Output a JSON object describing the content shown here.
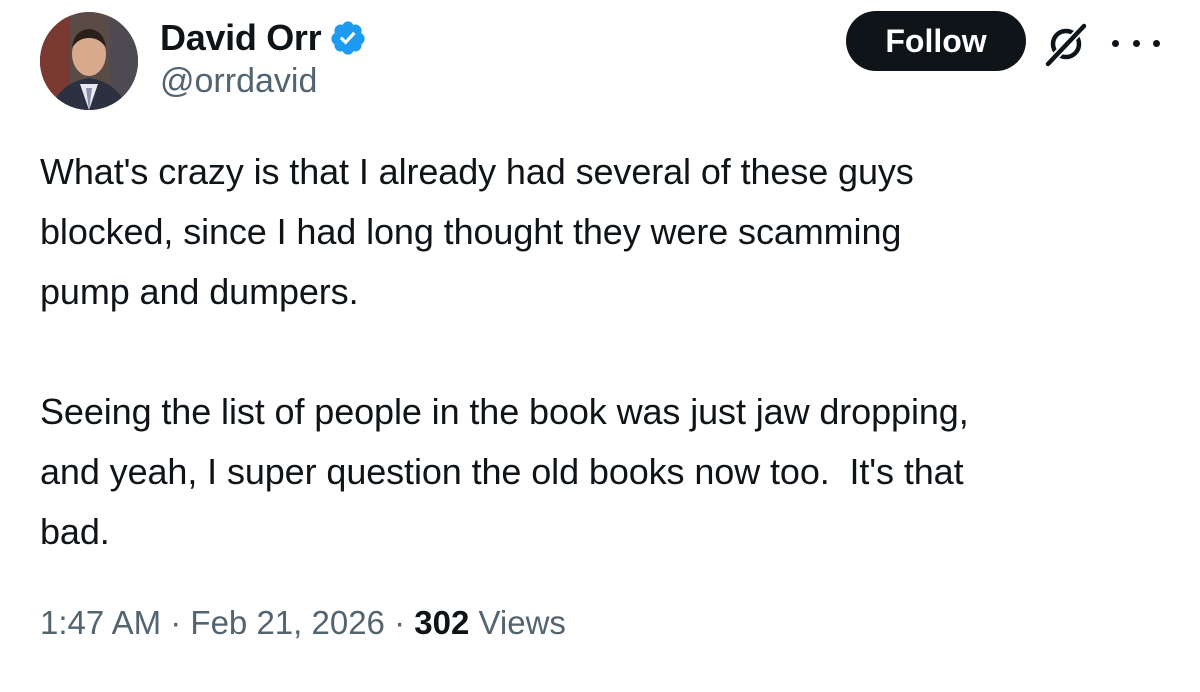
{
  "author": {
    "display_name": "David Orr",
    "handle": "@orrdavid",
    "verified": true,
    "verified_color": "#1d9bf0"
  },
  "actions": {
    "follow_label": "Follow",
    "grok_icon": "grok-icon",
    "more_icon": "more-options-icon"
  },
  "tweet": {
    "paragraphs": [
      "What's crazy is that I already had several of these guys\nblocked, since I had long thought they were scamming\npump and dumpers.",
      "Seeing the list of people in the book was just jaw dropping,\nand yeah, I super question the old books now too.  It's that\nbad."
    ]
  },
  "meta": {
    "time": "1:47 AM",
    "separator": " · ",
    "date": "Feb 21, 2026",
    "views_count": "302",
    "views_label": " Views"
  },
  "colors": {
    "text": "#0f1419",
    "secondary": "#536471",
    "button_bg": "#0f1419"
  }
}
